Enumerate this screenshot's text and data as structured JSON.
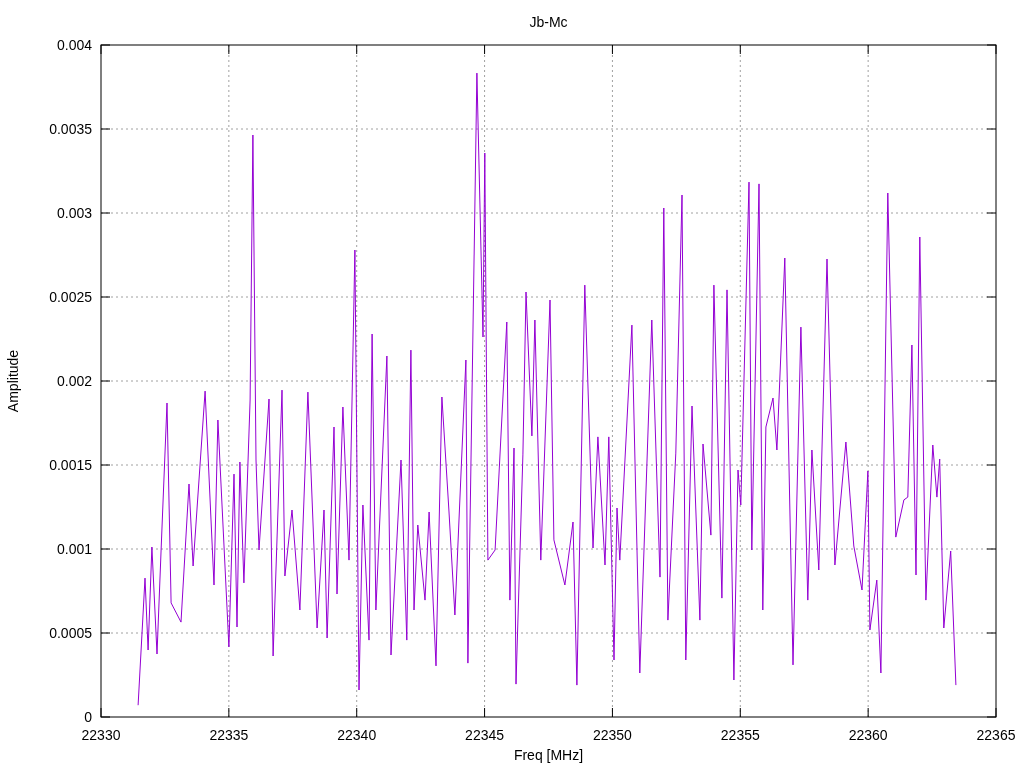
{
  "chart_data": {
    "type": "line",
    "grid": true,
    "title": "Jb-Mc",
    "xlabel": "Freq [MHz]",
    "ylabel": "Amplitude",
    "xlim": [
      22330,
      22365
    ],
    "ylim": [
      0,
      0.004
    ],
    "xticks": [
      22330,
      22335,
      22340,
      22345,
      22350,
      22355,
      22360,
      22365
    ],
    "yticks": [
      0,
      0.0005,
      0.001,
      0.0015,
      0.002,
      0.0025,
      0.003,
      0.0035,
      0.004
    ],
    "x": [
      22331.45,
      22331.72,
      22331.84,
      22331.99,
      22332.19,
      22332.35,
      22332.58,
      22332.74,
      22333.13,
      22333.44,
      22333.6,
      22334.07,
      22334.42,
      22334.57,
      22335.0,
      22335.2,
      22335.32,
      22335.43,
      22335.59,
      22335.83,
      22335.94,
      22336.06,
      22336.18,
      22336.57,
      22336.73,
      22337.08,
      22337.19,
      22337.47,
      22337.78,
      22338.09,
      22338.45,
      22338.72,
      22338.84,
      22339.11,
      22339.23,
      22339.46,
      22339.7,
      22339.93,
      22340.09,
      22340.24,
      22340.48,
      22340.6,
      22340.75,
      22341.18,
      22341.34,
      22341.73,
      22341.96,
      22342.12,
      22342.24,
      22342.39,
      22342.67,
      22342.83,
      22343.1,
      22343.33,
      22343.61,
      22343.84,
      22344.27,
      22344.35,
      22344.7,
      22344.94,
      22345.01,
      22345.13,
      22345.41,
      22345.87,
      22345.99,
      22346.15,
      22346.23,
      22346.5,
      22346.62,
      22346.85,
      22346.97,
      22347.2,
      22347.56,
      22347.71,
      22348.14,
      22348.46,
      22348.61,
      22348.92,
      22349.24,
      22349.43,
      22349.71,
      22349.86,
      22350.06,
      22350.18,
      22350.29,
      22350.76,
      22351.07,
      22351.54,
      22351.86,
      22352.01,
      22352.17,
      22352.48,
      22352.72,
      22352.87,
      22353.11,
      22353.42,
      22353.54,
      22353.85,
      22353.97,
      22354.28,
      22354.48,
      22354.75,
      22354.91,
      22355.02,
      22355.34,
      22355.45,
      22355.73,
      22355.88,
      22356.0,
      22356.28,
      22356.43,
      22356.74,
      22357.06,
      22357.37,
      22357.64,
      22357.8,
      22358.07,
      22358.39,
      22358.7,
      22359.13,
      22359.44,
      22359.76,
      22359.99,
      22360.07,
      22360.34,
      22360.5,
      22360.77,
      22361.08,
      22361.4,
      22361.55,
      22361.71,
      22361.87,
      22362.02,
      22362.26,
      22362.53,
      22362.69,
      22362.8,
      22362.96,
      22363.23,
      22363.43
    ],
    "series": [
      {
        "color": "#9400d3",
        "values": [
          7e-05,
          0.000827,
          0.000399,
          0.001012,
          0.000375,
          0.000994,
          0.001869,
          0.000679,
          0.000565,
          0.001387,
          0.000899,
          0.00194,
          0.000786,
          0.001768,
          0.000417,
          0.001446,
          0.000536,
          0.001518,
          0.000798,
          0.001887,
          0.003464,
          0.00153,
          0.000994,
          0.001893,
          0.000363,
          0.001946,
          0.000839,
          0.001232,
          0.000637,
          0.001934,
          0.00053,
          0.001232,
          0.00047,
          0.001726,
          0.000732,
          0.001845,
          0.000934,
          0.00278,
          0.000161,
          0.001262,
          0.000458,
          0.00228,
          0.000637,
          0.002149,
          0.000369,
          0.00153,
          0.000458,
          0.002184,
          0.000637,
          0.001143,
          0.000696,
          0.00122,
          0.000304,
          0.001905,
          0.00122,
          0.000607,
          0.002125,
          0.000321,
          0.003833,
          0.002262,
          0.003357,
          0.000934,
          0.000994,
          0.002351,
          0.000696,
          0.001601,
          0.000196,
          0.00156,
          0.00253,
          0.001673,
          0.002363,
          0.000934,
          0.002482,
          0.001054,
          0.000786,
          0.001161,
          0.00019,
          0.002571,
          0.001006,
          0.001667,
          0.000905,
          0.001667,
          0.000339,
          0.001244,
          0.000934,
          0.002333,
          0.000262,
          0.002363,
          0.000833,
          0.00303,
          0.000577,
          0.001571,
          0.003107,
          0.000339,
          0.001851,
          0.000577,
          0.001625,
          0.001083,
          0.002571,
          0.000708,
          0.002542,
          0.00022,
          0.00147,
          0.001262,
          0.003184,
          0.000994,
          0.003173,
          0.000637,
          0.001726,
          0.001899,
          0.001589,
          0.002732,
          0.00031,
          0.002321,
          0.000696,
          0.001589,
          0.000875,
          0.002726,
          0.000905,
          0.001637,
          0.001018,
          0.000756,
          0.001464,
          0.000518,
          0.000815,
          0.000262,
          0.003119,
          0.001071,
          0.001292,
          0.001309,
          0.002214,
          0.000845,
          0.002857,
          0.000696,
          0.001619,
          0.001309,
          0.001536,
          0.00053,
          0.000988,
          0.00019
        ]
      }
    ]
  }
}
